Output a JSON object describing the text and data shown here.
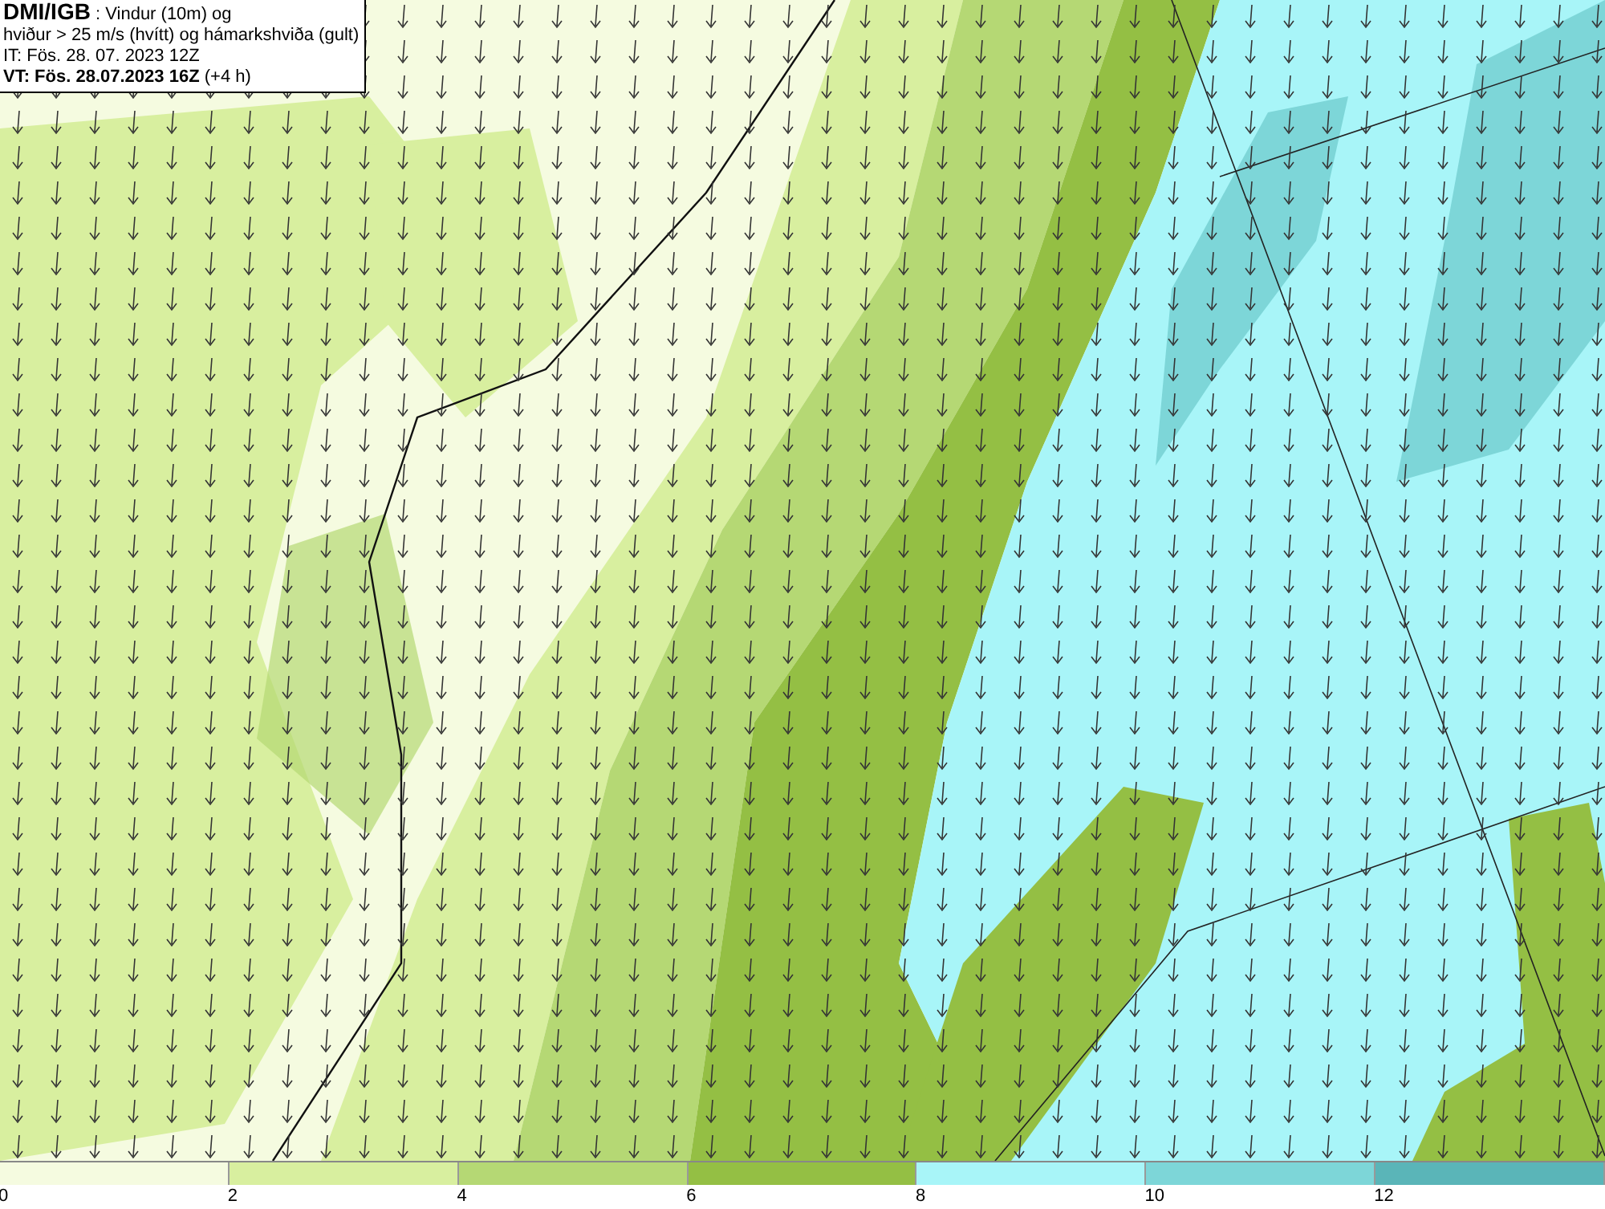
{
  "header": {
    "lines": [
      "**DMI/IGB** : Vindur (10m) og",
      "hviður > 25 m/s (hvítt) og hámarkshviða (gult)",
      "IT: Fös. 28. 07. 2023 12Z",
      "**VT: Fös. 28.07.2023 16Z** (+4 h)"
    ]
  },
  "legend": {
    "bins": [
      {
        "color": "#f5fbe0",
        "tick": "0"
      },
      {
        "color": "#d8ef9f",
        "tick": "2"
      },
      {
        "color": "#b5d874",
        "tick": "4"
      },
      {
        "color": "#94bf44",
        "tick": "6"
      },
      {
        "color": "#a8f5f8",
        "tick": "8"
      },
      {
        "color": "#7dd6d8",
        "tick": "10"
      },
      {
        "color": "#5ab5b8",
        "tick": "12"
      }
    ]
  }
}
